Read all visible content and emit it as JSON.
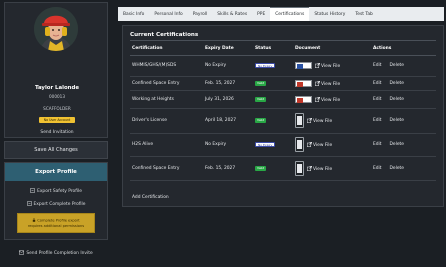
{
  "profile": {
    "name": "Taylor Lalonde",
    "employee_id": "000013",
    "role": "SCAFFOLDER",
    "account_badge": "No User Account",
    "send_invitation": "Send Invitation"
  },
  "actions": {
    "save_all": "Save All Changes"
  },
  "export": {
    "title": "Export Profile",
    "safety": "Export Safety Profile",
    "complete": "Export Complete Profile",
    "warning_line1": "Complete Profile export",
    "warning_line2": "requires additional permissions"
  },
  "send_completion": "Send Profile Completion Invite",
  "tabs": [
    "Basic Info",
    "Personal Info",
    "Payroll",
    "Skills & Rates",
    "PPE",
    "Certifications",
    "Status History",
    "Test Tab"
  ],
  "certifications": {
    "title": "Current Certifications",
    "headers": [
      "Certification",
      "Expiry Date",
      "Status",
      "Document",
      "Actions"
    ],
    "rows": [
      {
        "name": "WHMIS/GHS/(M)SDS",
        "expiry": "No Expiry",
        "status": "No Expiry",
        "view": "View File",
        "edit": "Edit",
        "delete": "Delete"
      },
      {
        "name": "Confined Space Entry",
        "expiry": "Feb. 15, 2027",
        "status": "Valid",
        "view": "View File",
        "edit": "Edit",
        "delete": "Delete"
      },
      {
        "name": "Working at Heights",
        "expiry": "July 31, 2026",
        "status": "Valid",
        "view": "View File",
        "edit": "Edit",
        "delete": "Delete"
      },
      {
        "name": "Driver's License",
        "expiry": "April 18, 2027",
        "status": "Valid",
        "view": "View File",
        "edit": "Edit",
        "delete": "Delete"
      },
      {
        "name": "H2S Alive",
        "expiry": "No Expiry",
        "status": "No Expiry",
        "view": "View File",
        "edit": "Edit",
        "delete": "Delete"
      },
      {
        "name": "Confined Space Entry",
        "expiry": "Feb. 15, 2027",
        "status": "Valid",
        "view": "View File",
        "edit": "Edit",
        "delete": "Delete"
      }
    ],
    "add_label": "Add Certification"
  },
  "colors": {
    "valid": "#28a745",
    "warning": "#c9a227",
    "export_header": "#2e5f72",
    "badge": "#f0c232"
  }
}
